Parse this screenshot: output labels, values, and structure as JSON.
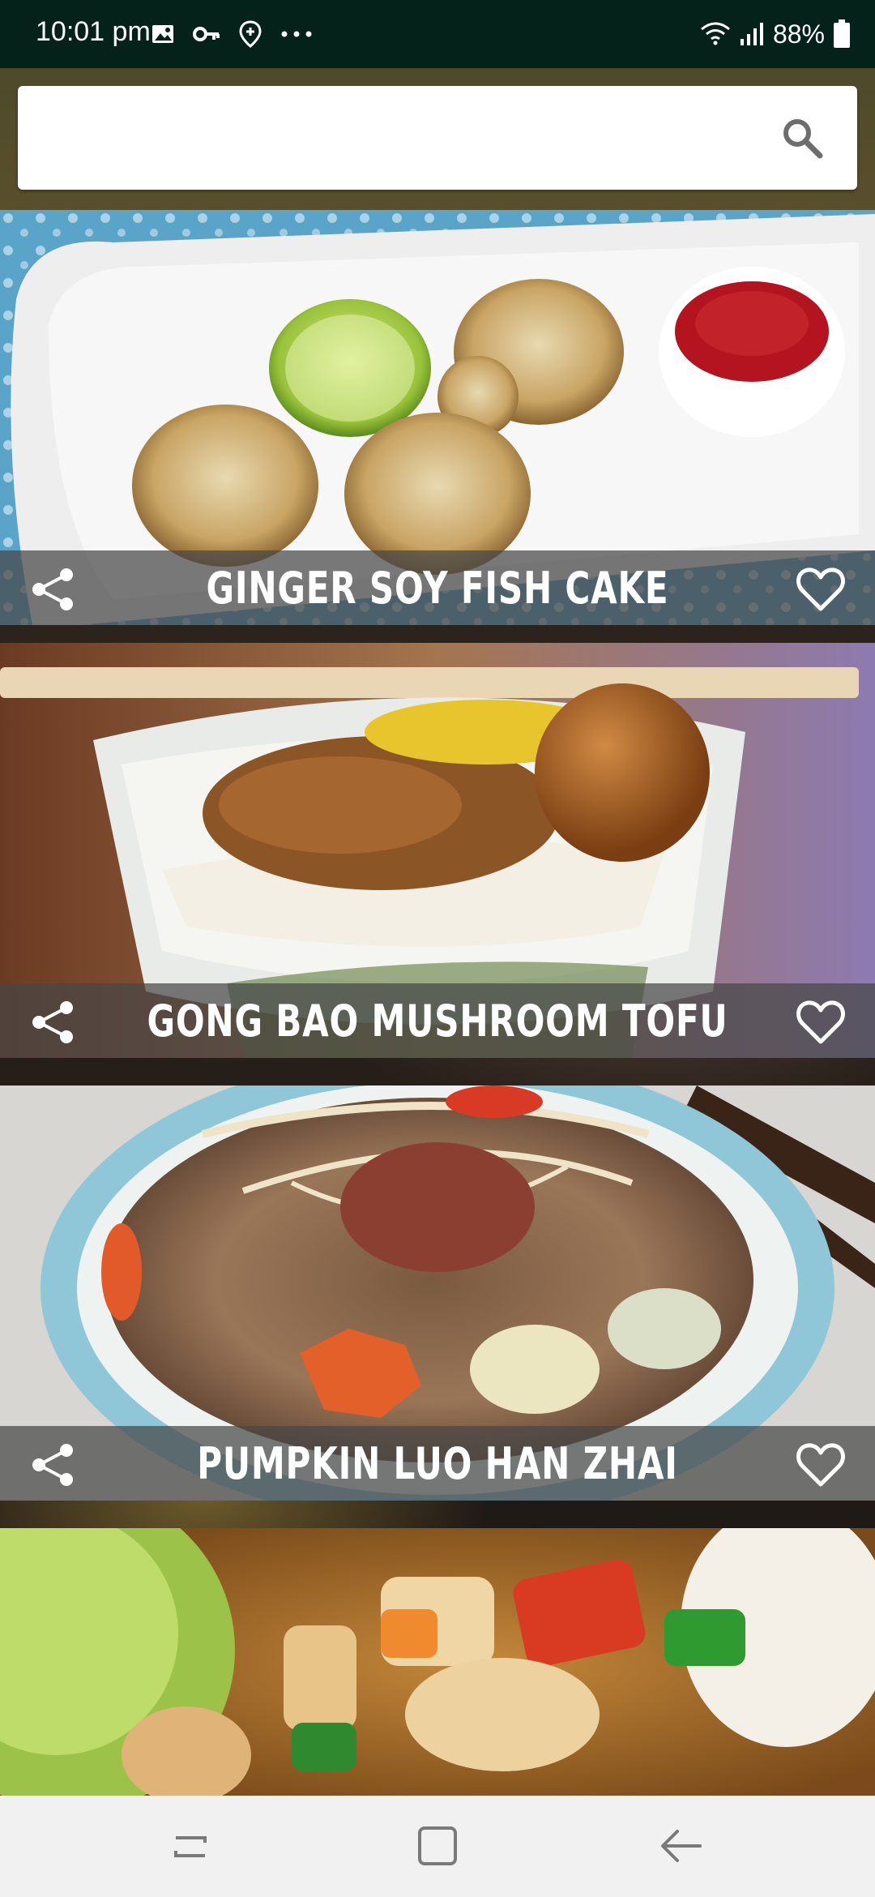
{
  "status_bar": {
    "time": "10:01 pm",
    "battery": "88%",
    "left_icons": [
      "image-icon",
      "key-icon",
      "location-plus-icon",
      "more-dots-icon"
    ],
    "right_icons": [
      "wifi-icon",
      "signal-icon",
      "battery-icon"
    ]
  },
  "search": {
    "placeholder": "",
    "value": "",
    "icon": "search-icon"
  },
  "recipes": [
    {
      "title": "GINGER SOY FISH CAKE"
    },
    {
      "title": "GONG BAO MUSHROOM TOFU"
    },
    {
      "title": "PUMPKIN LUO HAN ZHAI"
    },
    {
      "title": ""
    }
  ],
  "card_icons": {
    "share": "share-icon",
    "favorite": "heart-icon"
  },
  "nav_bar": {
    "buttons": [
      "recent-apps-icon",
      "home-icon",
      "back-icon"
    ]
  },
  "colors": {
    "status_bar": "#05221a",
    "caption_overlay": "#464646",
    "nav_bar": "#f1f1f1"
  }
}
